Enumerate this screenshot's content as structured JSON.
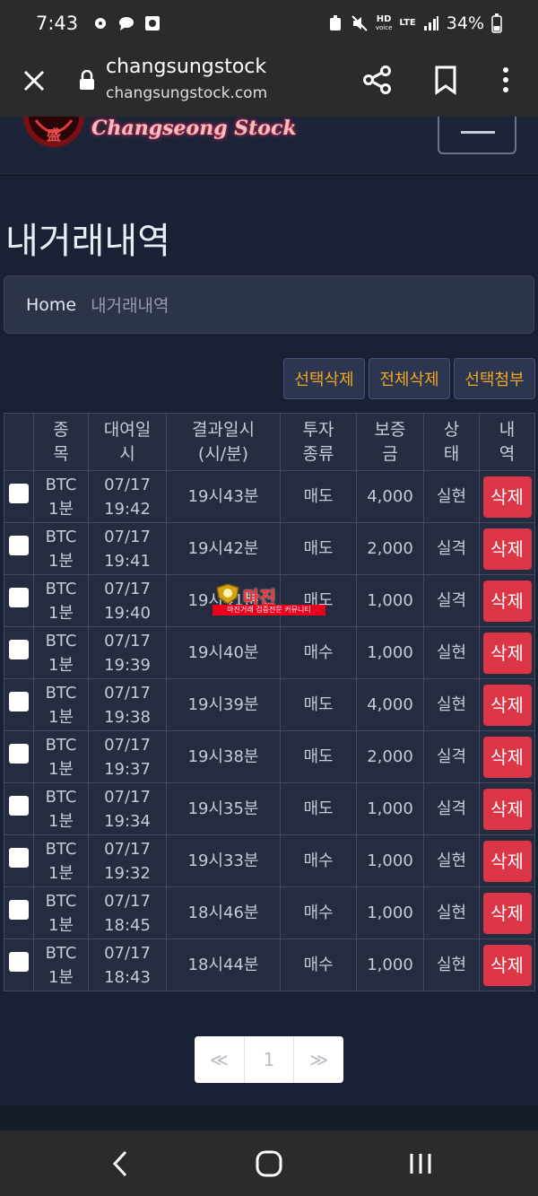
{
  "status_bar": {
    "time": "7:43",
    "network_top": "HD",
    "network_sub": "voice",
    "lte": "LTE",
    "battery": "34%"
  },
  "browser": {
    "title": "changsungstock",
    "url": "changsungstock.com"
  },
  "site": {
    "logo_text": "Changseong Stock"
  },
  "page": {
    "title": "내거래내역",
    "breadcrumb": {
      "home": "Home",
      "current": "내거래내역"
    }
  },
  "actions": {
    "select_delete": "선택삭제",
    "delete_all": "전체삭제",
    "select_attach": "선택첨부"
  },
  "table": {
    "headers": [
      "종\n목",
      "대여일\n시",
      "결과일시\n(시/분)",
      "투자\n종류",
      "보증\n금",
      "상\n태",
      "내\n역"
    ],
    "delete_label": "삭제",
    "rows": [
      {
        "item": "BTC\n1분",
        "date": "07/17\n19:42",
        "result_time": "19시43분",
        "type": "매도",
        "deposit": "4,000",
        "status": "실현",
        "win": true
      },
      {
        "item": "BTC\n1분",
        "date": "07/17\n19:41",
        "result_time": "19시42분",
        "type": "매도",
        "deposit": "2,000",
        "status": "실격",
        "win": false
      },
      {
        "item": "BTC\n1분",
        "date": "07/17\n19:40",
        "result_time": "19시41분",
        "type": "매도",
        "deposit": "1,000",
        "status": "실격",
        "win": false
      },
      {
        "item": "BTC\n1분",
        "date": "07/17\n19:39",
        "result_time": "19시40분",
        "type": "매수",
        "deposit": "1,000",
        "status": "실현",
        "win": true
      },
      {
        "item": "BTC\n1분",
        "date": "07/17\n19:38",
        "result_time": "19시39분",
        "type": "매도",
        "deposit": "4,000",
        "status": "실현",
        "win": true
      },
      {
        "item": "BTC\n1분",
        "date": "07/17\n19:37",
        "result_time": "19시38분",
        "type": "매도",
        "deposit": "2,000",
        "status": "실격",
        "win": false
      },
      {
        "item": "BTC\n1분",
        "date": "07/17\n19:34",
        "result_time": "19시35분",
        "type": "매도",
        "deposit": "1,000",
        "status": "실격",
        "win": false
      },
      {
        "item": "BTC\n1분",
        "date": "07/17\n19:32",
        "result_time": "19시33분",
        "type": "매수",
        "deposit": "1,000",
        "status": "실현",
        "win": true
      },
      {
        "item": "BTC\n1분",
        "date": "07/17\n18:45",
        "result_time": "18시46분",
        "type": "매수",
        "deposit": "1,000",
        "status": "실현",
        "win": true
      },
      {
        "item": "BTC\n1분",
        "date": "07/17\n18:43",
        "result_time": "18시44분",
        "type": "매수",
        "deposit": "1,000",
        "status": "실현",
        "win": true
      }
    ]
  },
  "watermark": {
    "title": "마진",
    "subtitle": "마진거래 검증전문 커뮤니티"
  },
  "pagination": {
    "first": "≪",
    "page": "1",
    "last": "≫"
  },
  "colors": {
    "win": "#2fbf4b",
    "lose": "#e0323c",
    "action_text": "#f0a820",
    "delete_bg": "#dc3545"
  }
}
